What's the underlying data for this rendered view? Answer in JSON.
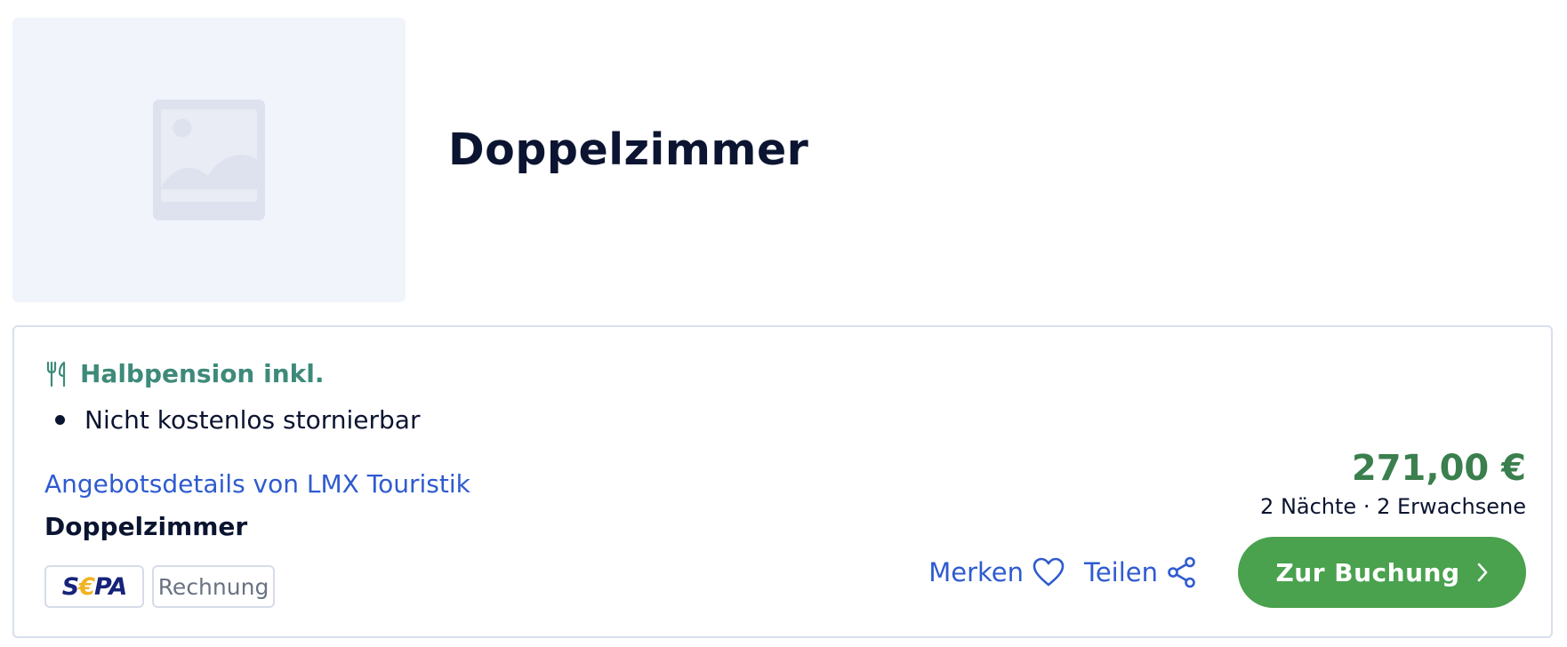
{
  "room": {
    "title": "Doppelzimmer",
    "image_icon": "image-placeholder-icon"
  },
  "offer": {
    "board": {
      "label": "Halbpension inkl.",
      "icon": "cutlery-icon",
      "color": "#3e8a7a"
    },
    "cancellation": {
      "label": "Nicht kostenlos stornierbar"
    },
    "details_link": "Angebotsdetails von LMX Touristik",
    "room_type": "Doppelzimmer",
    "payments": {
      "sepa_prefix": "S",
      "sepa_euro": "€",
      "sepa_suffix": "PA",
      "invoice": "Rechnung"
    },
    "price": "271,00 €",
    "price_note": "2 Nächte · 2 Erwachsene",
    "actions": {
      "save_label": "Merken",
      "save_icon": "heart-icon",
      "share_label": "Teilen",
      "share_icon": "share-icon",
      "book_label": "Zur Buchung",
      "book_icon": "chevron-right-icon"
    }
  },
  "colors": {
    "accent_link": "#2f5bd0",
    "price": "#3a7f4d",
    "book_button": "#4aa14e",
    "text_dark": "#0b1430",
    "border": "#d8dfec"
  }
}
